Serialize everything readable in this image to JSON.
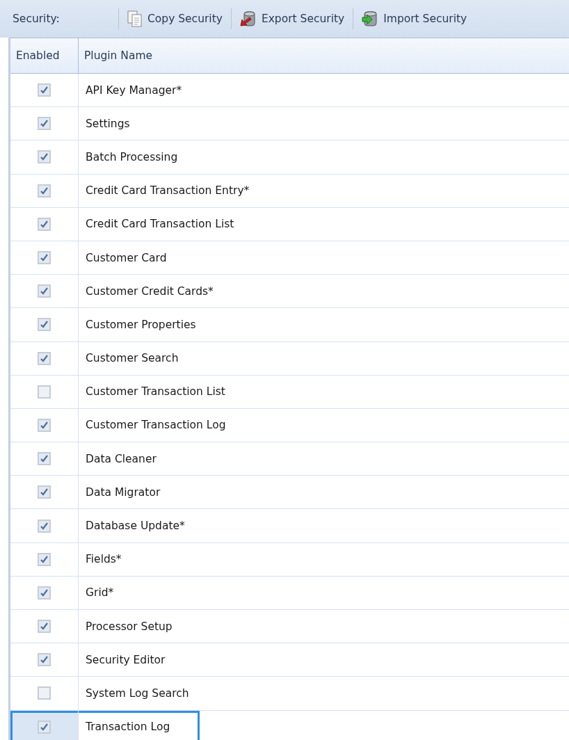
{
  "toolbar": {
    "label": "Security:",
    "buttons": [
      {
        "kind": "copy",
        "label": "Copy Security"
      },
      {
        "kind": "export",
        "label": "Export Security"
      },
      {
        "kind": "import",
        "label": "Import Security"
      }
    ]
  },
  "table": {
    "columns": [
      "Enabled",
      "Plugin Name"
    ],
    "rows": [
      {
        "enabled": true,
        "name": "API Key Manager*",
        "selected": false
      },
      {
        "enabled": true,
        "name": "Settings",
        "selected": false
      },
      {
        "enabled": true,
        "name": "Batch Processing",
        "selected": false
      },
      {
        "enabled": true,
        "name": "Credit Card Transaction Entry*",
        "selected": false
      },
      {
        "enabled": true,
        "name": "Credit Card Transaction List",
        "selected": false
      },
      {
        "enabled": true,
        "name": "Customer Card",
        "selected": false
      },
      {
        "enabled": true,
        "name": "Customer Credit Cards*",
        "selected": false
      },
      {
        "enabled": true,
        "name": "Customer Properties",
        "selected": false
      },
      {
        "enabled": true,
        "name": "Customer Search",
        "selected": false
      },
      {
        "enabled": false,
        "name": "Customer Transaction List",
        "selected": false
      },
      {
        "enabled": true,
        "name": "Customer Transaction Log",
        "selected": false
      },
      {
        "enabled": true,
        "name": "Data Cleaner",
        "selected": false
      },
      {
        "enabled": true,
        "name": "Data Migrator",
        "selected": false
      },
      {
        "enabled": true,
        "name": "Database Update*",
        "selected": false
      },
      {
        "enabled": true,
        "name": "Fields*",
        "selected": false
      },
      {
        "enabled": true,
        "name": "Grid*",
        "selected": false
      },
      {
        "enabled": true,
        "name": "Processor Setup",
        "selected": false
      },
      {
        "enabled": true,
        "name": "Security Editor",
        "selected": false
      },
      {
        "enabled": false,
        "name": "System Log Search",
        "selected": false
      },
      {
        "enabled": true,
        "name": "Transaction Log",
        "selected": true
      }
    ]
  }
}
